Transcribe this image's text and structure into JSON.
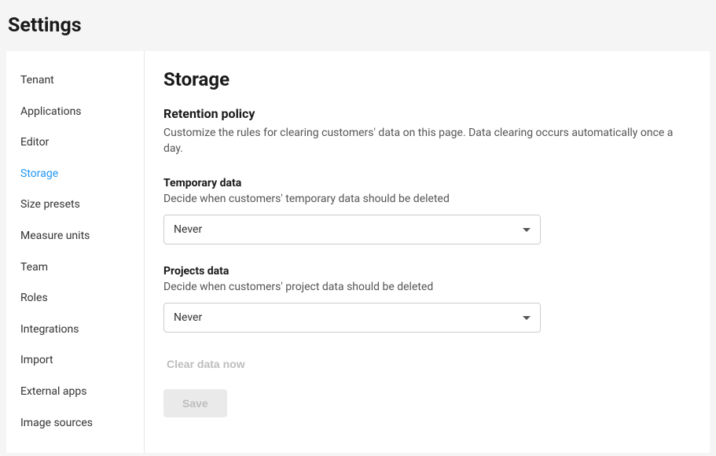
{
  "header": {
    "title": "Settings"
  },
  "sidebar": {
    "items": [
      {
        "label": "Tenant",
        "active": false
      },
      {
        "label": "Applications",
        "active": false
      },
      {
        "label": "Editor",
        "active": false
      },
      {
        "label": "Storage",
        "active": true
      },
      {
        "label": "Size presets",
        "active": false
      },
      {
        "label": "Measure units",
        "active": false
      },
      {
        "label": "Team",
        "active": false
      },
      {
        "label": "Roles",
        "active": false
      },
      {
        "label": "Integrations",
        "active": false
      },
      {
        "label": "Import",
        "active": false
      },
      {
        "label": "External apps",
        "active": false
      },
      {
        "label": "Image sources",
        "active": false
      }
    ]
  },
  "main": {
    "title": "Storage",
    "retention": {
      "heading": "Retention policy",
      "description": "Customize the rules for clearing customers' data on this page. Data clearing occurs automatically once a day."
    },
    "temporary": {
      "label": "Temporary data",
      "description": "Decide when customers' temporary data should be deleted",
      "value": "Never"
    },
    "projects": {
      "label": "Projects data",
      "description": "Decide when customers' project data should be deleted",
      "value": "Never"
    },
    "clear_now_label": "Clear data now",
    "save_label": "Save"
  }
}
